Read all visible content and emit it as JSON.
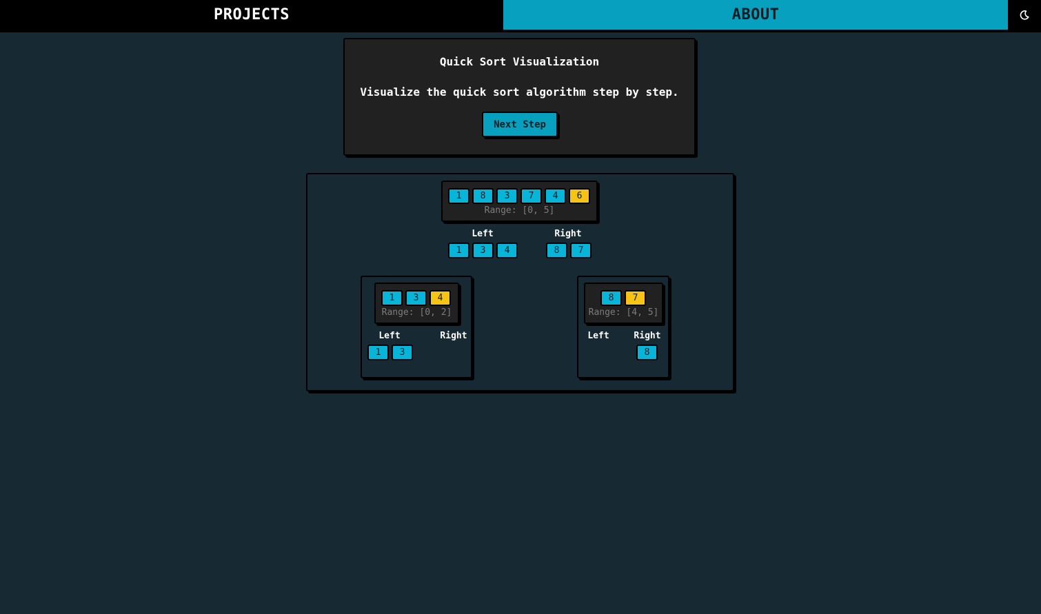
{
  "nav": {
    "projects_label": "PROJECTS",
    "about_label": "ABOUT",
    "theme_icon": "moon-icon"
  },
  "card": {
    "title": "Quick Sort Visualization",
    "description": "Visualize the quick sort algorithm step by step.",
    "next_step_label": "Next Step"
  },
  "visualization": {
    "root": {
      "array": [
        "1",
        "8",
        "3",
        "7",
        "4",
        "6"
      ],
      "pivot_value": "6",
      "range": "Range: [0, 5]",
      "left_label": "Left",
      "right_label": "Right",
      "left": [
        "1",
        "3",
        "4"
      ],
      "right": [
        "8",
        "7"
      ]
    },
    "left_child": {
      "array": [
        "1",
        "3",
        "4"
      ],
      "pivot_value": "4",
      "range": "Range: [0, 2]",
      "left_label": "Left",
      "right_label": "Right",
      "left": [
        "1",
        "3"
      ],
      "right": []
    },
    "right_child": {
      "array": [
        "8",
        "7"
      ],
      "pivot_value": "7",
      "range": "Range: [4, 5]",
      "left_label": "Left",
      "right_label": "Right",
      "left": [],
      "right": [
        "8"
      ]
    }
  },
  "colors": {
    "background": "#172933",
    "accent": "#07a0bf",
    "cell": "#07b5d8",
    "pivot": "#f7c315",
    "card": "#212121"
  }
}
